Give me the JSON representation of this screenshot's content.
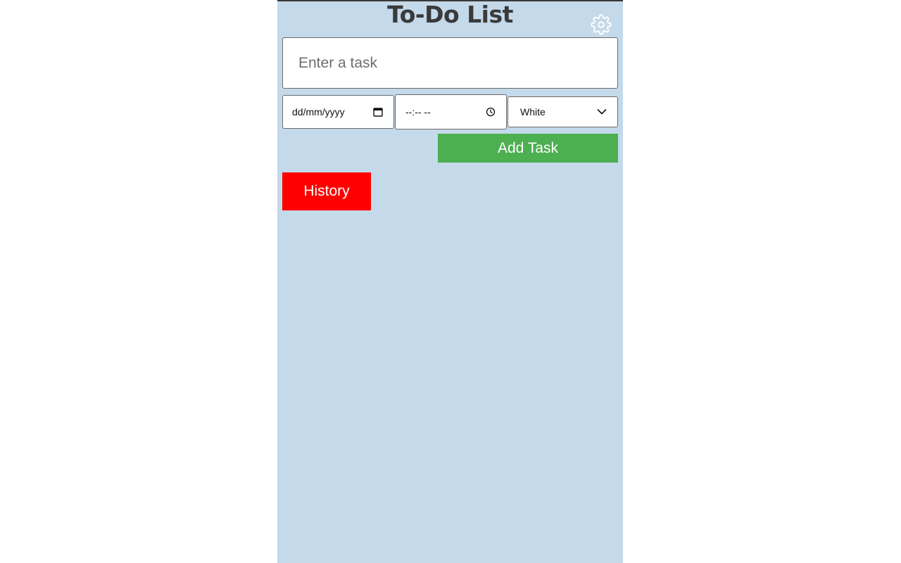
{
  "app": {
    "title": "To-Do List",
    "background_color": "#c4d9ea"
  },
  "header": {
    "settings_icon": "gear-icon"
  },
  "task_form": {
    "task_placeholder": "Enter a task",
    "task_value": "",
    "date_placeholder": "dd/mm/yyyy",
    "date_icon": "calendar-icon",
    "time_placeholder": "--:-- --",
    "time_icon": "clock-icon",
    "color_selected": "White",
    "color_dropdown_icon": "chevron-down-icon",
    "add_button_label": "Add Task",
    "add_button_color": "#4caf50"
  },
  "history": {
    "button_label": "History",
    "button_color": "#ff0000"
  }
}
